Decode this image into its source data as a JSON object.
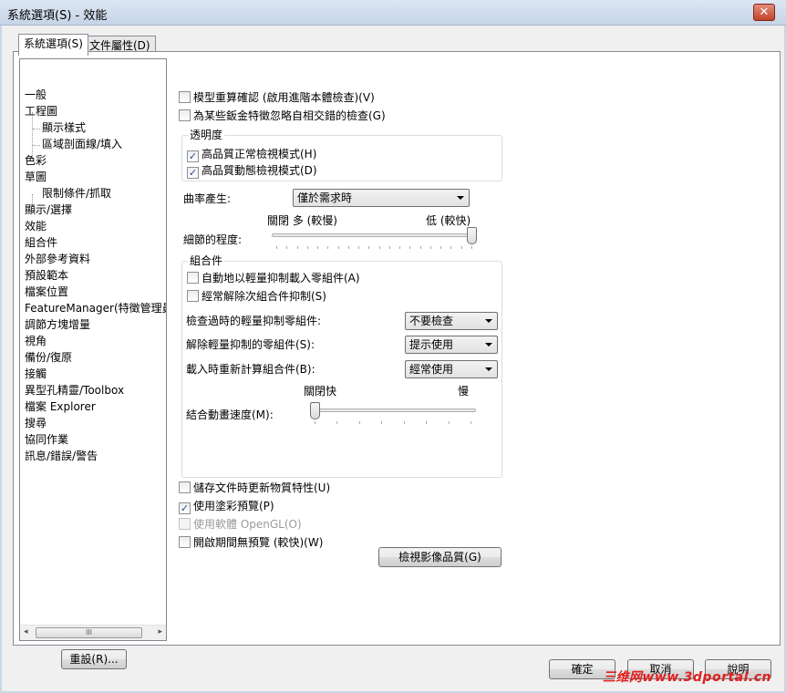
{
  "window": {
    "title": "系統選項(S) - 效能",
    "close_glyph": "✕"
  },
  "tabs": [
    {
      "label": "系統選項(S)",
      "active": true
    },
    {
      "label": "文件屬性(D)",
      "active": false
    }
  ],
  "tree": {
    "items": [
      {
        "label": "一般",
        "level": 0
      },
      {
        "label": "工程圖",
        "level": 0
      },
      {
        "label": "顯示樣式",
        "level": 1
      },
      {
        "label": "區域剖面線/填入",
        "level": 1
      },
      {
        "label": "色彩",
        "level": 0
      },
      {
        "label": "草圖",
        "level": 0
      },
      {
        "label": "限制條件/抓取",
        "level": 1
      },
      {
        "label": "顯示/選擇",
        "level": 0
      },
      {
        "label": "效能",
        "level": 0
      },
      {
        "label": "組合件",
        "level": 0
      },
      {
        "label": "外部參考資料",
        "level": 0
      },
      {
        "label": "預設範本",
        "level": 0
      },
      {
        "label": "檔案位置",
        "level": 0
      },
      {
        "label": "FeatureManager(特徵管理員",
        "level": 0
      },
      {
        "label": "調節方塊增量",
        "level": 0
      },
      {
        "label": "視角",
        "level": 0
      },
      {
        "label": "備份/復原",
        "level": 0
      },
      {
        "label": "接觸",
        "level": 0
      },
      {
        "label": "異型孔精靈/Toolbox",
        "level": 0
      },
      {
        "label": "檔案 Explorer",
        "level": 0
      },
      {
        "label": "搜尋",
        "level": 0
      },
      {
        "label": "協同作業",
        "level": 0
      },
      {
        "label": "訊息/錯誤/警告",
        "level": 0
      }
    ],
    "scroll_thumb_glyph": "III",
    "scroll_left_glyph": "◂",
    "scroll_right_glyph": "▸"
  },
  "reset_button": "重設(R)...",
  "options": {
    "rebuild_verify": {
      "label": "模型重算確認 (啟用進階本體檢查)(V)",
      "checked": false
    },
    "ignore_self_intersect": {
      "label": "為某些鈑金特徵忽略自相交錯的檢查(G)",
      "checked": false
    },
    "transparency": {
      "title": "透明度",
      "high_quality_normal": {
        "label": "高品質正常檢視模式(H)",
        "checked": true
      },
      "high_quality_dynamic": {
        "label": "高品質動態檢視模式(D)",
        "checked": true
      }
    },
    "curvature": {
      "label": "曲率產生:",
      "value": "僅於需求時"
    },
    "level_of_detail": {
      "label": "細節的程度:",
      "left_label": "關閉 多 (較慢)",
      "right_label": "低 (較快)",
      "value_percent": 100
    },
    "assemblies": {
      "title": "組合件",
      "auto_lightweight": {
        "label": "自動地以輕量抑制載入零組件(A)",
        "checked": false
      },
      "always_resolve": {
        "label": "經常解除次組合件抑制(S)",
        "checked": false
      },
      "check_outdated": {
        "label": "檢查過時的輕量抑制零組件:",
        "value": "不要檢查"
      },
      "resolve_lightweight": {
        "label": "解除輕量抑制的零組件(S):",
        "value": "提示使用"
      },
      "rebuild_on_load": {
        "label": "載入時重新計算組合件(B):",
        "value": "經常使用"
      },
      "animation_speed": {
        "label": "結合動畫速度(M):",
        "left_label": "關閉快",
        "right_label": "慢",
        "value_percent": 0
      }
    },
    "update_mass_props": {
      "label": "儲存文件時更新物質特性(U)",
      "checked": false
    },
    "shaded_preview": {
      "label": "使用塗彩預覽(P)",
      "checked": true
    },
    "software_opengl": {
      "label": "使用軟體 OpenGL(O)",
      "checked": false,
      "disabled": true
    },
    "no_preview_on_open": {
      "label": "開啟期間無預覽 (較快)(W)",
      "checked": false
    },
    "image_quality_button": "檢視影像品質(G)"
  },
  "footer": {
    "ok": "確定",
    "cancel": "取消",
    "help": "說明"
  },
  "watermark": "三维网www.3dportal.cn",
  "check_glyph": "✓"
}
